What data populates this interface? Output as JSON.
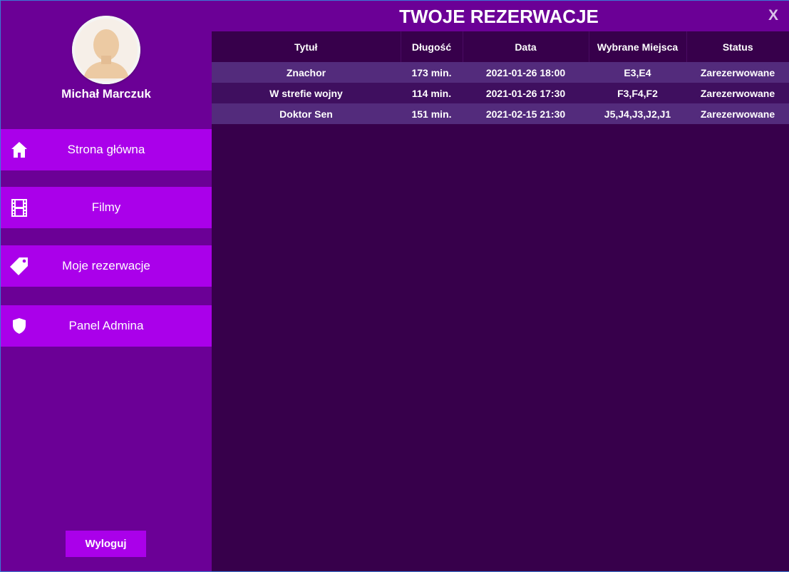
{
  "header": {
    "title": "TWOJE REZERWACJE",
    "close_label": "X"
  },
  "user": {
    "name": "Michał Marczuk",
    "avatar_icon": "user-avatar-icon"
  },
  "nav": {
    "items": [
      {
        "label": "Strona główna",
        "icon": "home-icon"
      },
      {
        "label": "Filmy",
        "icon": "film-icon"
      },
      {
        "label": "Moje rezerwacje",
        "icon": "tag-icon"
      },
      {
        "label": "Panel Admina",
        "icon": "shield-icon"
      }
    ]
  },
  "logout_label": "Wyloguj",
  "table": {
    "columns": [
      "Tytuł",
      "Długość",
      "Data",
      "Wybrane Miejsca",
      "Status"
    ],
    "rows": [
      [
        "Znachor",
        "173 min.",
        "2021-01-26 18:00",
        "E3,E4",
        "Zarezerwowane"
      ],
      [
        "W strefie wojny",
        "114 min.",
        "2021-01-26 17:30",
        "F3,F4,F2",
        "Zarezerwowane"
      ],
      [
        "Doktor Sen",
        "151 min.",
        "2021-02-15 21:30",
        "J5,J4,J3,J2,J1",
        "Zarezerwowane"
      ]
    ]
  },
  "colors": {
    "sidebar_bg": "#6b0096",
    "nav_button_bg": "#aa00ea",
    "content_bg": "#37004b",
    "row_odd_bg": "#532b7c",
    "row_even_bg": "#3f0f5f"
  }
}
